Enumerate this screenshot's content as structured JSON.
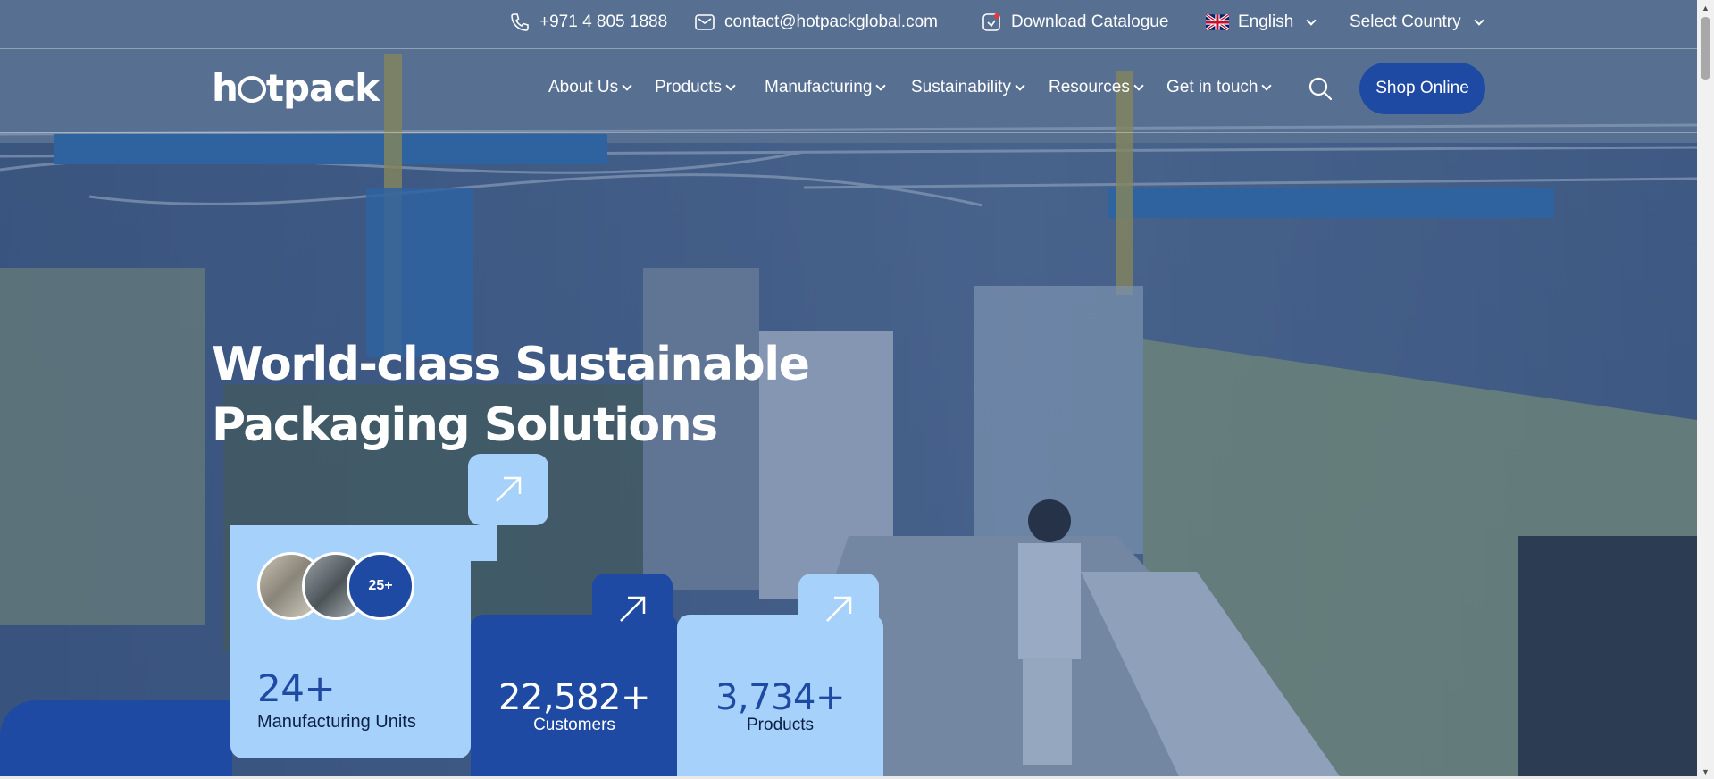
{
  "topbar": {
    "phone": "+971 4 805 1888",
    "email": "contact@hotpackglobal.com",
    "catalogue": "Download Catalogue",
    "language": "English",
    "country": "Select Country"
  },
  "brand": {
    "logo_left": "h",
    "logo_right": "tpack"
  },
  "nav": {
    "items": [
      {
        "label": "About Us"
      },
      {
        "label": "Products"
      },
      {
        "label": "Manufacturing"
      },
      {
        "label": "Sustainability"
      },
      {
        "label": "Resources"
      },
      {
        "label": "Get in touch"
      }
    ],
    "shop_label": "Shop Online"
  },
  "hero": {
    "headline_line1": "World-class Sustainable",
    "headline_line2": "Packaging Solutions"
  },
  "stats": {
    "badge": "25+",
    "units_value": "24+",
    "units_label": "Manufacturing Units",
    "customers_value": "22,582+",
    "customers_label": "Customers",
    "products_value": "3,734+",
    "products_label": "Products"
  },
  "colors": {
    "brand_blue": "#1e4aa3",
    "light_blue": "#a6d1fb"
  },
  "icons": [
    "phone-icon",
    "email-icon",
    "catalogue-icon",
    "uk-flag-icon",
    "search-icon",
    "arrow-up-right-icon"
  ]
}
